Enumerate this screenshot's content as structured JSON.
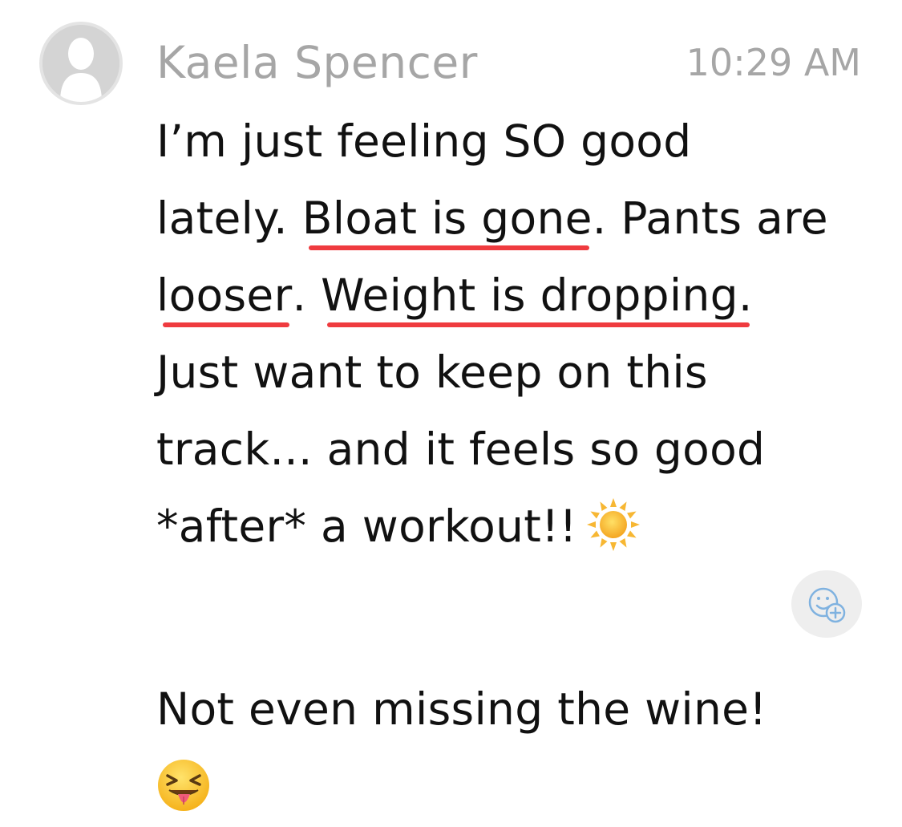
{
  "sender": {
    "name": "Kaela Spencer",
    "avatar_icon": "default-person-avatar"
  },
  "timestamp": "10:29 AM",
  "message": {
    "lines": [
      {
        "segments": [
          {
            "text": "I’m just feeling SO good",
            "underline": false
          }
        ]
      },
      {
        "segments": [
          {
            "text": "lately. ",
            "underline": false
          },
          {
            "text": "Bloat is gone",
            "underline": true
          },
          {
            "text": ". Pants are",
            "underline": false
          }
        ]
      },
      {
        "segments": [
          {
            "text": "looser",
            "underline": true
          },
          {
            "text": ". ",
            "underline": false
          },
          {
            "text": "Weight is dropping.",
            "underline": true
          }
        ]
      },
      {
        "segments": [
          {
            "text": "Just want to keep on this",
            "underline": false
          }
        ]
      },
      {
        "segments": [
          {
            "text": "track... and it feels so good",
            "underline": false
          }
        ]
      },
      {
        "segments": [
          {
            "text": "*after* a workout!!",
            "underline": false
          }
        ]
      }
    ],
    "trailing_emoji_icon": "sun-emoji",
    "underline_color": "#ef3b3f"
  },
  "reaction_button": {
    "icon": "add-reaction-icon"
  },
  "second_message": {
    "text": "Not even missing the wine!",
    "emoji_icon": "squinting-tongue-emoji"
  },
  "colors": {
    "meta_text": "#a6a6a6",
    "body_text": "#111111",
    "underline": "#ef3b3f",
    "avatar_bg": "#d4d4d4",
    "reaction_bg": "#eeeeee",
    "reaction_icon": "#7fb2e0"
  }
}
